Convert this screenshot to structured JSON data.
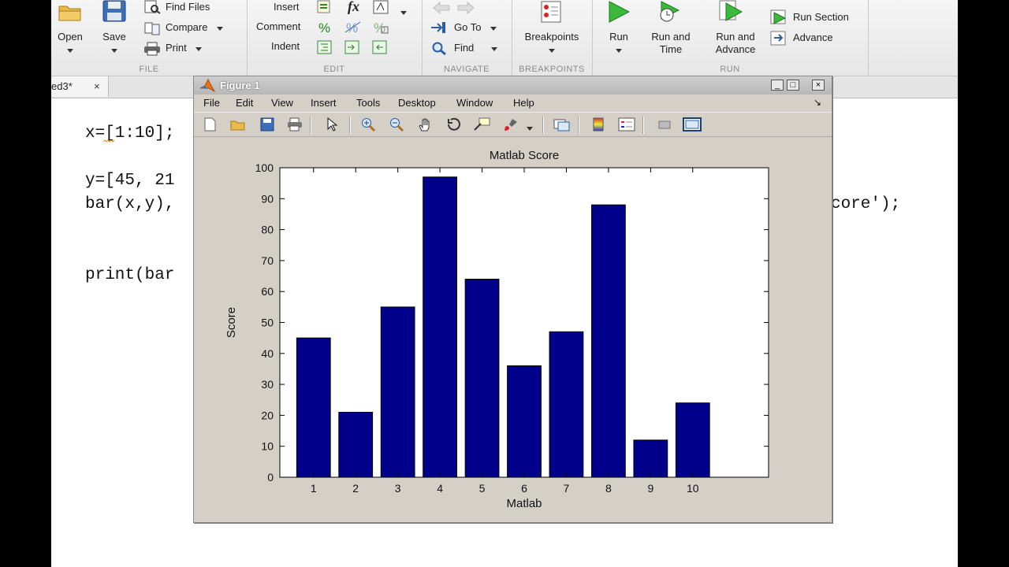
{
  "toolstrip": {
    "file": {
      "title": "FILE",
      "open_label": "Open",
      "save_label": "Save",
      "find_files_label": "Find Files",
      "compare_label": "Compare",
      "print_label": "Print"
    },
    "edit": {
      "title": "EDIT",
      "insert_label": "Insert",
      "comment_label": "Comment",
      "indent_label": "Indent",
      "fx_label": "fx"
    },
    "navigate": {
      "title": "NAVIGATE",
      "goto_label": "Go To",
      "find_label": "Find"
    },
    "breakpoints": {
      "title": "BREAKPOINTS",
      "breakpoints_label": "Breakpoints"
    },
    "run": {
      "title": "RUN",
      "run_label": "Run",
      "run_and_time_l1": "Run and",
      "run_and_time_l2": "Time",
      "run_and_advance_l1": "Run and",
      "run_and_advance_l2": "Advance",
      "run_section_label": "Run Section",
      "advance_label": "Advance"
    }
  },
  "editor": {
    "tab_label": "ed3*",
    "tab_close": "×",
    "lines": {
      "l1": "x=[1:10];",
      "l2": "y=[45, 21",
      "l3a": "bar(x,y),",
      "l3b": "core');",
      "l4": "print(bar"
    }
  },
  "figure": {
    "title": "Figure 1",
    "menus": [
      "File",
      "Edit",
      "View",
      "Insert",
      "Tools",
      "Desktop",
      "Window",
      "Help"
    ],
    "dock_glyph": "↘",
    "controls": {
      "min": "_",
      "max": "□",
      "close": "×"
    }
  },
  "chart_data": {
    "type": "bar",
    "title": "Matlab Score",
    "xlabel": "Matlab",
    "ylabel": "Score",
    "categories": [
      "1",
      "2",
      "3",
      "4",
      "5",
      "6",
      "7",
      "8",
      "9",
      "10"
    ],
    "values": [
      45,
      21,
      55,
      97,
      64,
      36,
      47,
      88,
      12,
      24
    ],
    "ylim": [
      0,
      100
    ],
    "yticks": [
      0,
      10,
      20,
      30,
      40,
      50,
      60,
      70,
      80,
      90,
      100
    ],
    "bar_color": "#00008b",
    "grid": false
  },
  "colors": {
    "string_literal": "#a020f0",
    "run_green": "#2ea82e"
  }
}
